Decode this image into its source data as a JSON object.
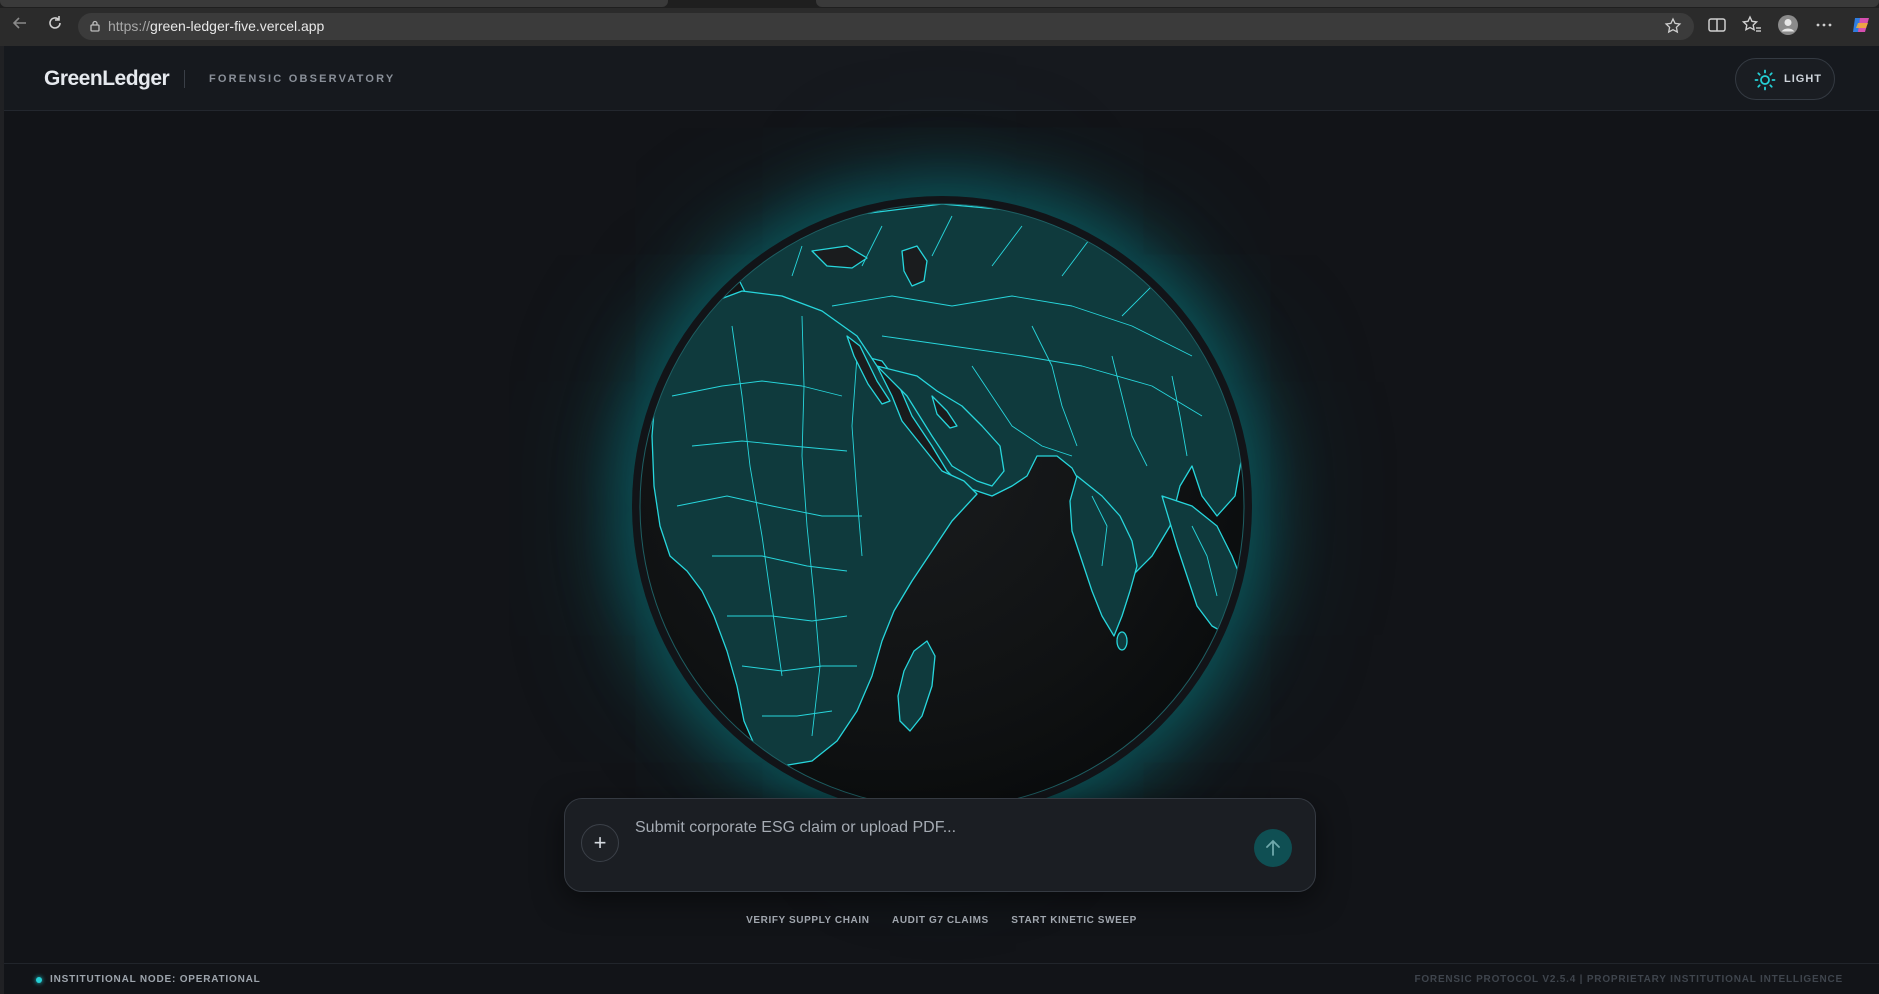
{
  "browser": {
    "url_scheme": "https://",
    "url_host": "green-ledger-five.vercel.app"
  },
  "header": {
    "logo": "GreenLedger",
    "subtitle": "FORENSIC OBSERVATORY",
    "theme_toggle_label": "LIGHT"
  },
  "prompt": {
    "placeholder": "Submit corporate ESG claim or upload PDF...",
    "attach_symbol": "+"
  },
  "quick_actions": [
    "VERIFY SUPPLY CHAIN",
    "AUDIT G7 CLAIMS",
    "START KINETIC SWEEP"
  ],
  "footer": {
    "status": "INSTITUTIONAL NODE: OPERATIONAL",
    "version": "FORENSIC PROTOCOL V2.5.4 | PROPRIETARY INSTITUTIONAL INTELLIGENCE"
  },
  "colors": {
    "accent": "#25d0d6",
    "background": "#121418",
    "land": "#0f3a3d"
  },
  "icons": [
    "back-icon",
    "refresh-icon",
    "lock-icon",
    "star-icon",
    "split-screen-icon",
    "favorites-icon",
    "profile-icon",
    "more-icon",
    "copilot-icon",
    "sun-icon",
    "plus-icon",
    "arrow-up-icon",
    "globe"
  ]
}
